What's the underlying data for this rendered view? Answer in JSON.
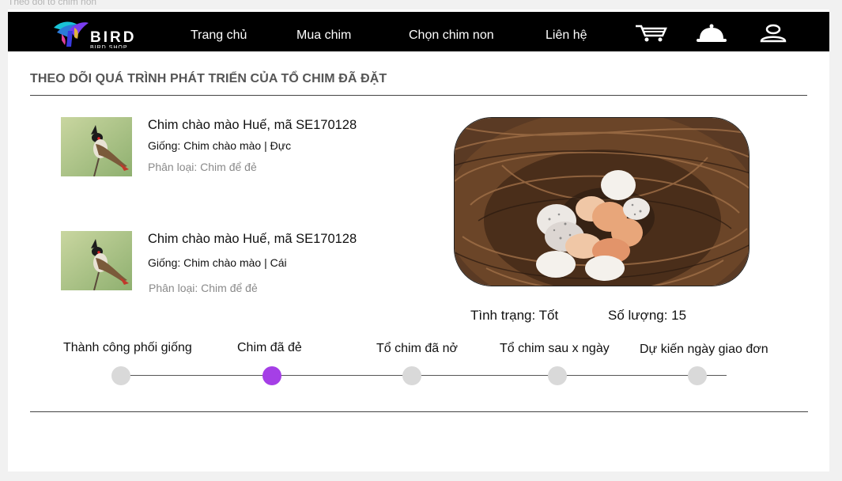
{
  "frame_label": "Theo dõi tổ chim non",
  "brand": {
    "name": "BIRD",
    "tagline": "BIRD SHOP"
  },
  "nav": {
    "items": [
      {
        "label": "Trang chủ"
      },
      {
        "label": "Mua chim"
      },
      {
        "label": "Chọn chim non"
      },
      {
        "label": "Liên hệ"
      }
    ],
    "icons": [
      "cart-icon",
      "bell-icon",
      "user-icon"
    ]
  },
  "page_title": "THEO DÕI QUÁ TRÌNH PHÁT TRIỂN CỦA TỔ CHIM ĐÃ ĐẶT",
  "birds": [
    {
      "name": "Chim chào mào Huế, mã SE170128",
      "breed": "Giống: Chim chào mào | Đực",
      "type": "Phân loại: Chim để đẻ"
    },
    {
      "name": "Chim chào mào Huế, mã SE170128",
      "breed": "Giống: Chim chào mào | Cái",
      "type": "Phân loại: Chim để đẻ"
    }
  ],
  "nest": {
    "status": "Tình trạng: Tốt",
    "quantity": "Số lượng: 15"
  },
  "progress": {
    "current_step": 1,
    "steps": [
      {
        "label": "Thành công phối giống"
      },
      {
        "label": "Chim đã đẻ"
      },
      {
        "label": "Tổ chim đã nở"
      },
      {
        "label": "Tổ chim sau x ngày"
      },
      {
        "label": "Dự kiến ngày giao đơn"
      }
    ]
  },
  "colors": {
    "navbar": "#000000",
    "active_step": "#a53fe6",
    "inactive_step": "#d9d9d9"
  }
}
